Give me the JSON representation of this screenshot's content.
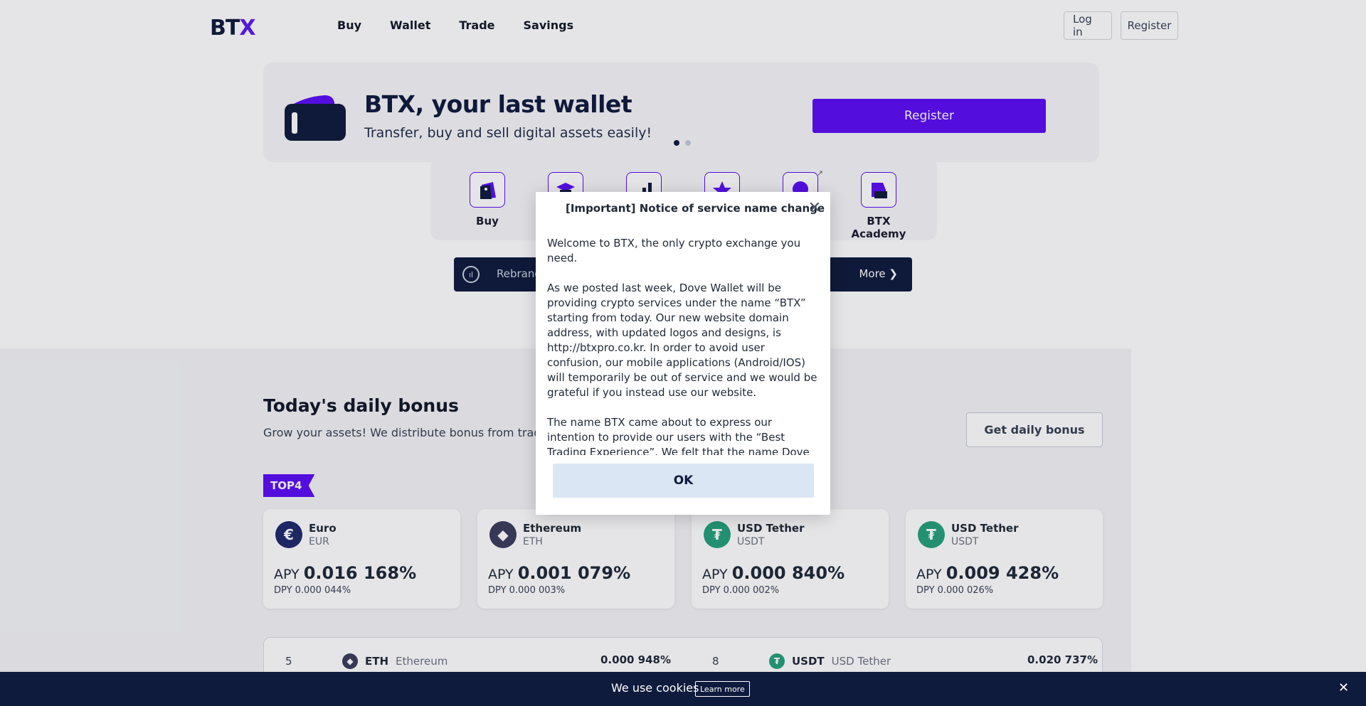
{
  "header": {
    "logo": "BTX",
    "nav": [
      "Buy",
      "Wallet",
      "Trade",
      "Savings"
    ],
    "login": "Log in",
    "register": "Register"
  },
  "hero": {
    "title": "BTX, your last wallet",
    "subtitle": "Transfer, buy and sell digital assets easily!",
    "register": "Register"
  },
  "quick_menu": [
    {
      "label": "Buy",
      "icon": "shopping-bag-icon"
    },
    {
      "label": "",
      "icon": "graduation-cap-icon"
    },
    {
      "label": "",
      "icon": "bar-chart-icon"
    },
    {
      "label": "",
      "icon": "star-icon"
    },
    {
      "label": "",
      "icon": "chat-icon"
    },
    {
      "label": "BTX Academy",
      "icon": "academy-icon"
    }
  ],
  "notice_bar": {
    "text": "Rebrand",
    "more": "More"
  },
  "bonus": {
    "title": "Today's daily bonus",
    "subtitle": "Grow your assets! We distribute bonus from trading f",
    "button": "Get daily bonus",
    "badge": "TOP4"
  },
  "cards": [
    {
      "name": "Euro",
      "symbol": "EUR",
      "apy_label": "APY",
      "apy": "0.016 168%",
      "dpy": "DPY 0.000 044%",
      "color": "#1e2a6b",
      "glyph": "€"
    },
    {
      "name": "Ethereum",
      "symbol": "ETH",
      "apy_label": "APY",
      "apy": "0.001 079%",
      "dpy": "DPY 0.000 003%",
      "color": "#3c3c5d",
      "glyph": "◆"
    },
    {
      "name": "USD Tether",
      "symbol": "USDT",
      "apy_label": "APY",
      "apy": "0.000 840%",
      "dpy": "DPY 0.000 002%",
      "color": "#26a17b",
      "glyph": "₮"
    },
    {
      "name": "USD Tether",
      "symbol": "USDT",
      "apy_label": "APY",
      "apy": "0.009 428%",
      "dpy": "DPY 0.000 026%",
      "color": "#26a17b",
      "glyph": "₮"
    }
  ],
  "ranking": [
    {
      "rank": "5",
      "symbol": "ETH",
      "name": "Ethereum",
      "value": "0.000 948%"
    },
    {
      "rank": "8",
      "symbol": "USDT",
      "name": "USD Tether",
      "value": "0.020 737%"
    }
  ],
  "modal": {
    "title": "[Important] Notice of service name change",
    "paragraphs": [
      "Welcome to BTX, the only crypto exchange you need.",
      "As we posted last week, Dove Wallet will be providing crypto services under the name “BTX” starting from today. Our new website domain address, with updated logos and designs, is http://btxpro.co.kr. In order to avoid user confusion, our mobile applications (Android/IOS) will temporarily be out of service and we would be grateful if you instead use our website.",
      "The name BTX came about to express our intention to provide our users with the “Best Trading Experience”. We felt that the name Dove Wallet was limiting in reflecting our purpose as an exchange. We present this new name, along with our intention to serve our"
    ],
    "ok": "OK"
  },
  "cookie": {
    "text": "We use cookies",
    "learn_more": "Learn more"
  }
}
